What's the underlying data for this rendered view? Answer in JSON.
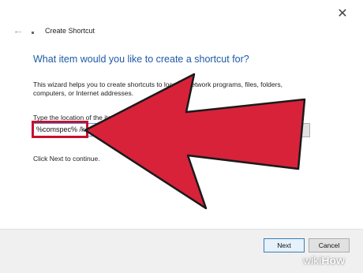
{
  "window": {
    "title": "Create Shortcut",
    "close_glyph": "✕",
    "back_glyph": "←"
  },
  "main": {
    "heading": "What item would you like to create a shortcut for?",
    "description": "This wizard helps you to create shortcuts to local or network programs, files, folders, computers, or Internet addresses.",
    "location_label": "Type the location of the item:",
    "location_value": "%comspec% /k",
    "browse_label": "Browse...",
    "continue_text": "Click Next to continue."
  },
  "footer": {
    "next_label": "Next",
    "cancel_label": "Cancel"
  },
  "annotation": {
    "arrow_color": "#d8223a",
    "highlight_color": "#c8102e"
  },
  "watermark": {
    "wiki": "wiki",
    "how": "How"
  }
}
